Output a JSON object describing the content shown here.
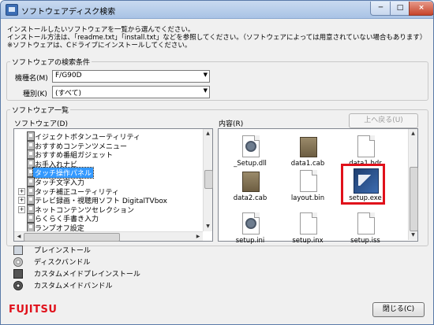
{
  "window": {
    "title": "ソフトウェアディスク検索"
  },
  "title_buttons": {
    "minimize": "─",
    "maximize": "□",
    "close": "×"
  },
  "instructions": [
    "インストールしたいソフトウェアを一覧から選んでください。",
    "インストール方法は、「readme.txt」「install.txt」などを参照してください。（ソフトウェアによっては用意されていない場合もあります）",
    "※ソフトウェアは、Cドライブにインストールしてください。"
  ],
  "search": {
    "group_label": "ソフトウェアの検索条件",
    "model_label": "機種名(M)",
    "model_value": "F/G90D",
    "type_label": "種別(K)",
    "type_value": "(すべて)"
  },
  "list": {
    "group_label": "ソフトウェア一覧",
    "software_label": "ソフトウェア(D)",
    "contents_label": "内容(R)",
    "back_button": "上へ戻る(U)",
    "tree_items": [
      {
        "label": "イジェクトボタンユーティリティ",
        "expander": ""
      },
      {
        "label": "おすすめコンテンツメニュー",
        "expander": ""
      },
      {
        "label": "おすすめ番組ガジェット",
        "expander": ""
      },
      {
        "label": "お手入れナビ",
        "expander": ""
      },
      {
        "label": "タッチ操作パネル",
        "expander": "",
        "selected": true
      },
      {
        "label": "タッチ文字入力",
        "expander": ""
      },
      {
        "label": "タッチ補正ユーティリティ",
        "expander": "+"
      },
      {
        "label": "テレビ録画・視聴用ソフト DigitalTVbox",
        "expander": "+"
      },
      {
        "label": "ネットコンテンツセレクション",
        "expander": "+"
      },
      {
        "label": "らくらく手書き入力",
        "expander": ""
      },
      {
        "label": "ランプオフ設定",
        "expander": ""
      }
    ],
    "files": [
      {
        "name": "_Setup.dll",
        "icon": "gear-doc"
      },
      {
        "name": "data1.cab",
        "icon": "cab"
      },
      {
        "name": "data1.hdr",
        "icon": "doc"
      },
      {
        "name": "data2.cab",
        "icon": "cab"
      },
      {
        "name": "layout.bin",
        "icon": "doc"
      },
      {
        "name": "setup.exe",
        "icon": "setup-exe",
        "highlighted": true
      },
      {
        "name": "setup.ini",
        "icon": "gear-doc"
      },
      {
        "name": "setup.inx",
        "icon": "doc"
      },
      {
        "name": "setup.iss",
        "icon": "doc"
      }
    ]
  },
  "legend": [
    {
      "label": "プレインストール",
      "icon": "preinstall-icon"
    },
    {
      "label": "ディスクバンドル",
      "icon": "disc-icon"
    },
    {
      "label": "カスタムメイドプレインストール",
      "icon": "custom-preinstall-icon"
    },
    {
      "label": "カスタムメイドバンドル",
      "icon": "custom-disc-icon"
    }
  ],
  "footer": {
    "logo": "FUJITSU",
    "close_button": "閉じる(C)"
  },
  "colors": {
    "accent_red": "#e0111b",
    "selection": "#3399ff"
  }
}
